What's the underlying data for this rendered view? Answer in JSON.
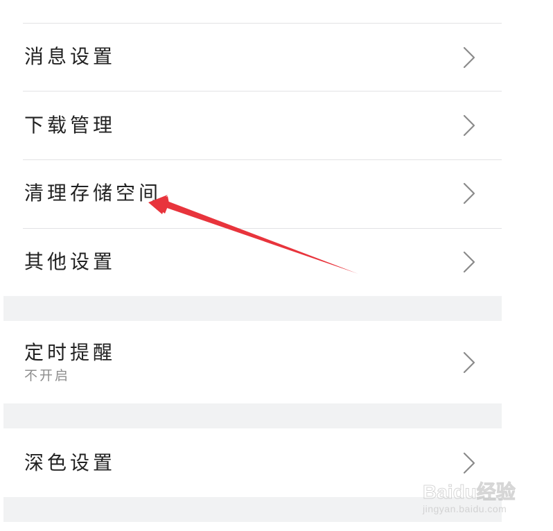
{
  "settings": {
    "group1": [
      {
        "label": "消息设置"
      },
      {
        "label": "下载管理"
      },
      {
        "label": "清理存储空间"
      },
      {
        "label": "其他设置"
      }
    ],
    "group2": [
      {
        "label": "定时提醒",
        "sublabel": "不开启"
      }
    ],
    "group3": [
      {
        "label": "深色设置"
      }
    ]
  },
  "icons": {
    "row_chevron": "chevron-right-icon",
    "annotation": "red-arrow-icon"
  },
  "colors": {
    "background": "#f1f2f3",
    "card": "#ffffff",
    "text": "#222222",
    "subtext": "#8d8d8d",
    "chevron": "#8a8a8a",
    "annotation_arrow": "#e8343c"
  },
  "watermark": {
    "brand": "Baidu经验",
    "url": "jingyan.baidu.com"
  }
}
